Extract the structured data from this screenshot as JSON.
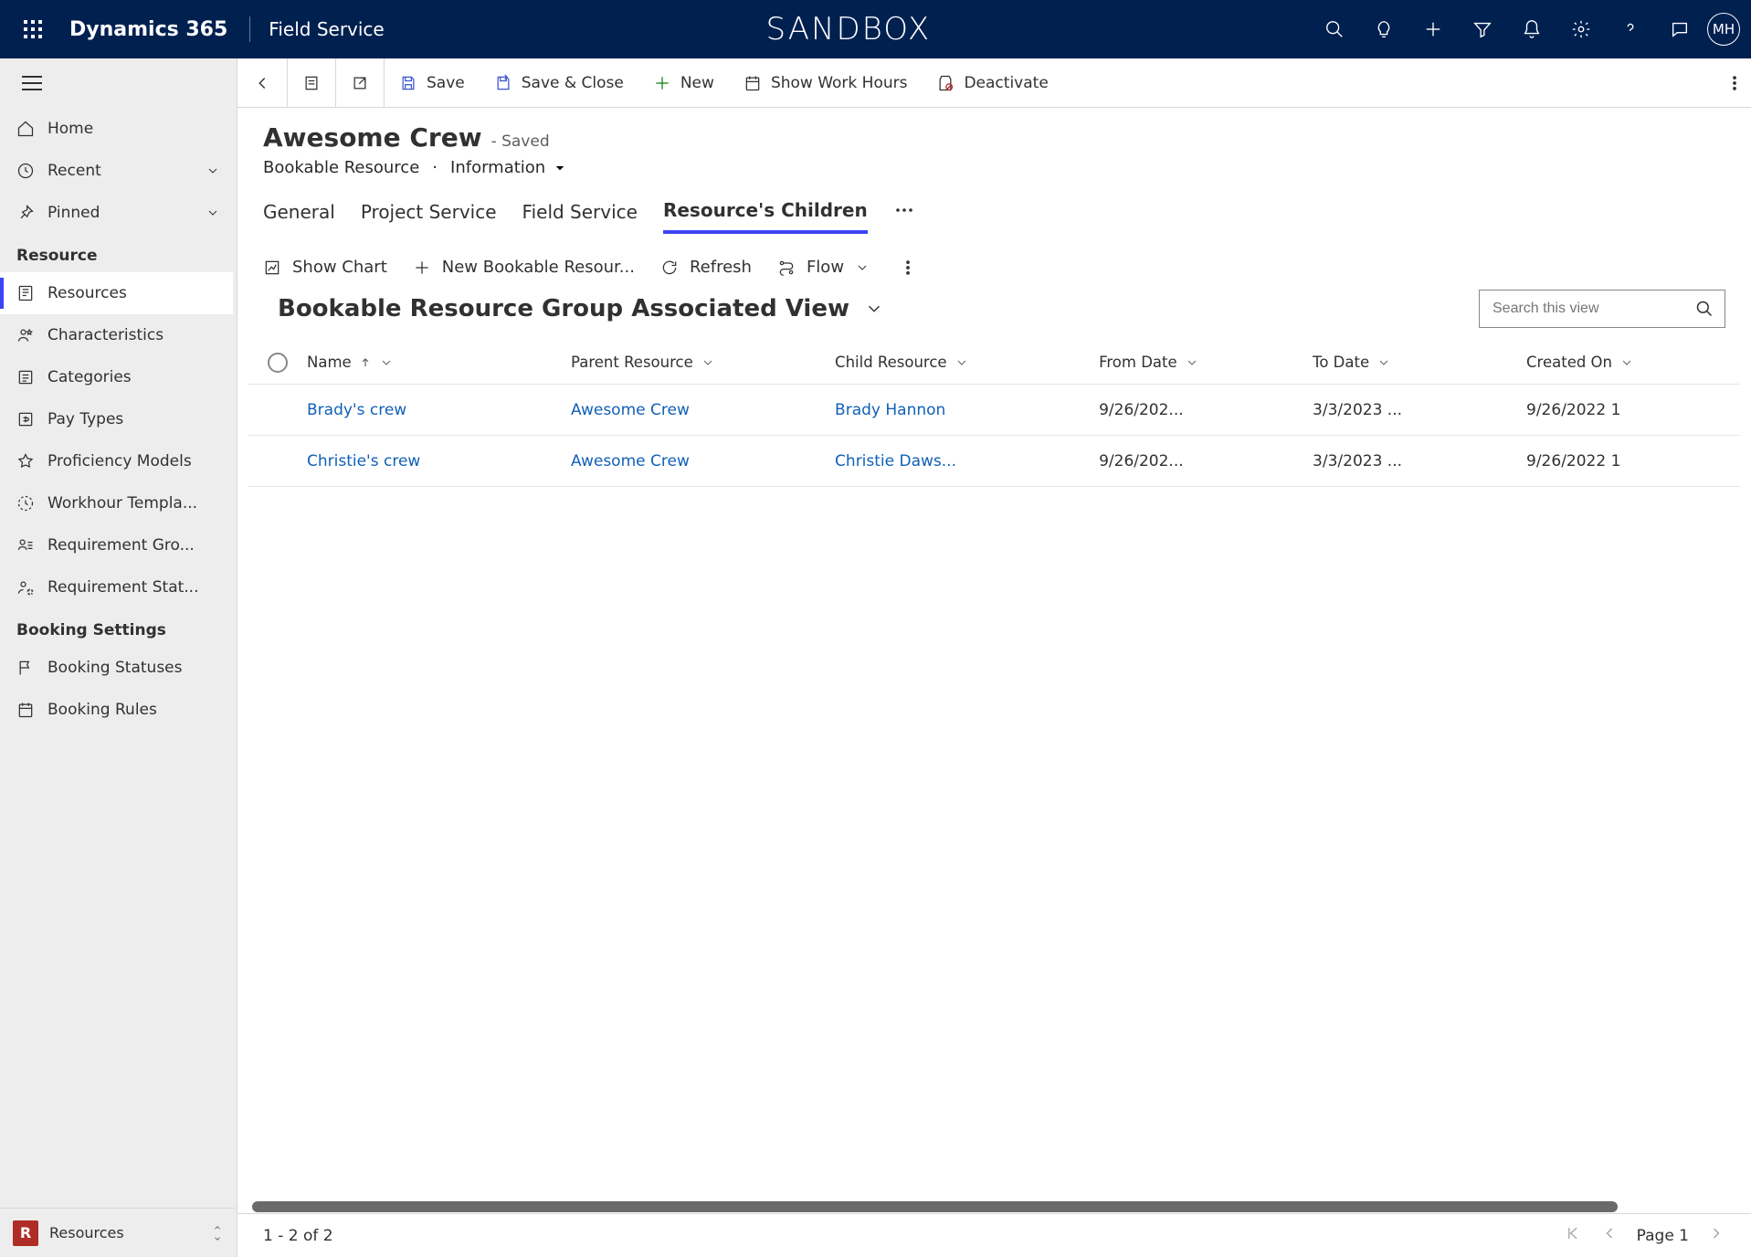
{
  "nav": {
    "brand": "Dynamics 365",
    "app": "Field Service",
    "env": "SANDBOX",
    "user_initials": "MH"
  },
  "sidebar": {
    "top": [
      {
        "name": "home",
        "label": "Home",
        "icon": "home"
      },
      {
        "name": "recent",
        "label": "Recent",
        "icon": "clock",
        "expand": true
      },
      {
        "name": "pinned",
        "label": "Pinned",
        "icon": "pin",
        "expand": true
      }
    ],
    "section_resource": "Resource",
    "resource_items": [
      {
        "name": "resources",
        "label": "Resources",
        "icon": "resource",
        "active": true
      },
      {
        "name": "characteristics",
        "label": "Characteristics",
        "icon": "person-star"
      },
      {
        "name": "categories",
        "label": "Categories",
        "icon": "list-box"
      },
      {
        "name": "pay-types",
        "label": "Pay Types",
        "icon": "money-box"
      },
      {
        "name": "proficiency-models",
        "label": "Proficiency Models",
        "icon": "star"
      },
      {
        "name": "workhour-templates",
        "label": "Workhour Templa...",
        "icon": "clock-dashed"
      },
      {
        "name": "requirement-groups",
        "label": "Requirement Gro...",
        "icon": "people-list"
      },
      {
        "name": "requirement-statuses",
        "label": "Requirement Stat...",
        "icon": "person-setting"
      }
    ],
    "section_booking": "Booking Settings",
    "booking_items": [
      {
        "name": "booking-statuses",
        "label": "Booking Statuses",
        "icon": "flag"
      },
      {
        "name": "booking-rules",
        "label": "Booking Rules",
        "icon": "calendar"
      }
    ],
    "app_picker": {
      "tile": "R",
      "label": "Resources"
    }
  },
  "commands": {
    "save": "Save",
    "save_close": "Save & Close",
    "new": "New",
    "show_hours": "Show Work Hours",
    "deactivate": "Deactivate"
  },
  "record": {
    "title": "Awesome Crew",
    "status": "- Saved",
    "entity": "Bookable Resource",
    "form": "Information"
  },
  "tabs": [
    {
      "name": "general",
      "label": "General"
    },
    {
      "name": "project-service",
      "label": "Project Service"
    },
    {
      "name": "field-service",
      "label": "Field Service"
    },
    {
      "name": "resources-children",
      "label": "Resource's Children",
      "active": true
    }
  ],
  "subcmd": {
    "show_chart": "Show Chart",
    "new_brg": "New Bookable Resour...",
    "refresh": "Refresh",
    "flow": "Flow"
  },
  "view": {
    "title": "Bookable Resource Group Associated View",
    "search_placeholder": "Search this view"
  },
  "columns": {
    "name": "Name",
    "parent": "Parent Resource",
    "child": "Child Resource",
    "from": "From Date",
    "to": "To Date",
    "created": "Created On"
  },
  "rows": [
    {
      "name": "Brady's crew",
      "parent": "Awesome Crew",
      "child": "Brady Hannon",
      "from": "9/26/202...",
      "to": "3/3/2023 ...",
      "created": "9/26/2022 1"
    },
    {
      "name": "Christie's crew",
      "parent": "Awesome Crew",
      "child": "Christie Daws...",
      "from": "9/26/202...",
      "to": "3/3/2023 ...",
      "created": "9/26/2022 1"
    }
  ],
  "pager": {
    "range": "1 - 2 of 2",
    "page": "Page 1"
  }
}
